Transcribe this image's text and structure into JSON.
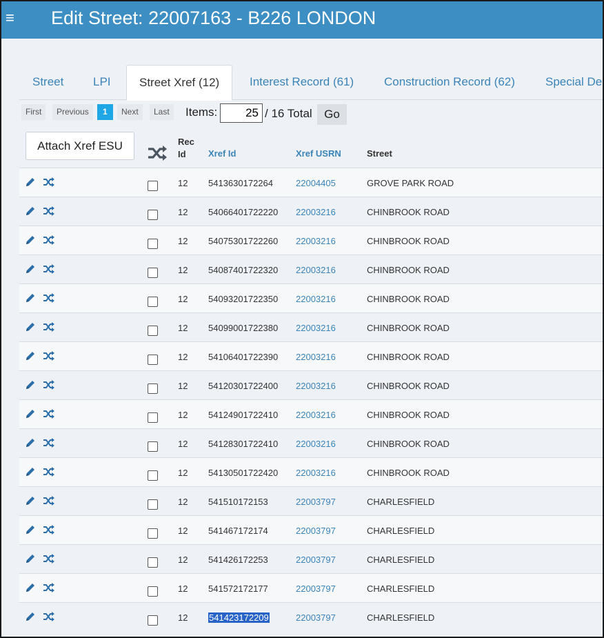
{
  "header": {
    "menu_icon": "≡",
    "title": "Edit Street: 22007163 - B226 LONDON"
  },
  "tabs": [
    {
      "label": "Street"
    },
    {
      "label": "LPI"
    },
    {
      "label": "Street Xref (12)",
      "active": true
    },
    {
      "label": "Interest Record (61)"
    },
    {
      "label": "Construction Record (62)"
    },
    {
      "label": "Special De"
    }
  ],
  "pager": {
    "first": "First",
    "previous": "Previous",
    "current": "1",
    "next": "Next",
    "last": "Last",
    "items_label": "Items:",
    "items_value": "25",
    "total_text": "/ 16 Total",
    "go": "Go"
  },
  "actions": {
    "attach": "Attach Xref ESU"
  },
  "columns": {
    "rec_id": "Rec\nId",
    "xref_id": "Xref Id",
    "xref_usrn": "Xref USRN",
    "street": "Street"
  },
  "rows": [
    {
      "rec_id": "12",
      "xref_id": "5413630172264",
      "usrn": "22004405",
      "street": "GROVE PARK ROAD"
    },
    {
      "rec_id": "12",
      "xref_id": "54066401722220",
      "usrn": "22003216",
      "street": "CHINBROOK ROAD"
    },
    {
      "rec_id": "12",
      "xref_id": "54075301722260",
      "usrn": "22003216",
      "street": "CHINBROOK ROAD"
    },
    {
      "rec_id": "12",
      "xref_id": "54087401722320",
      "usrn": "22003216",
      "street": "CHINBROOK ROAD"
    },
    {
      "rec_id": "12",
      "xref_id": "54093201722350",
      "usrn": "22003216",
      "street": "CHINBROOK ROAD"
    },
    {
      "rec_id": "12",
      "xref_id": "54099001722380",
      "usrn": "22003216",
      "street": "CHINBROOK ROAD"
    },
    {
      "rec_id": "12",
      "xref_id": "54106401722390",
      "usrn": "22003216",
      "street": "CHINBROOK ROAD"
    },
    {
      "rec_id": "12",
      "xref_id": "54120301722400",
      "usrn": "22003216",
      "street": "CHINBROOK ROAD"
    },
    {
      "rec_id": "12",
      "xref_id": "54124901722410",
      "usrn": "22003216",
      "street": "CHINBROOK ROAD"
    },
    {
      "rec_id": "12",
      "xref_id": "54128301722410",
      "usrn": "22003216",
      "street": "CHINBROOK ROAD"
    },
    {
      "rec_id": "12",
      "xref_id": "54130501722420",
      "usrn": "22003216",
      "street": "CHINBROOK ROAD"
    },
    {
      "rec_id": "12",
      "xref_id": "541510172153",
      "usrn": "22003797",
      "street": "CHARLESFIELD"
    },
    {
      "rec_id": "12",
      "xref_id": "541467172174",
      "usrn": "22003797",
      "street": "CHARLESFIELD"
    },
    {
      "rec_id": "12",
      "xref_id": "541426172253",
      "usrn": "22003797",
      "street": "CHARLESFIELD"
    },
    {
      "rec_id": "12",
      "xref_id": "541572172177",
      "usrn": "22003797",
      "street": "CHARLESFIELD"
    },
    {
      "rec_id": "12",
      "xref_id": "541423172209",
      "usrn": "22003797",
      "street": "CHARLESFIELD",
      "selected": true
    }
  ],
  "colors": {
    "header_bg": "#3d8ec2",
    "link": "#3a84b8",
    "current_page": "#1ea6e5",
    "selection": "#2864c8"
  },
  "icons": {
    "row_edit": "pencil-icon",
    "row_link": "shuffle-icon",
    "header": "shuffle-icon"
  }
}
